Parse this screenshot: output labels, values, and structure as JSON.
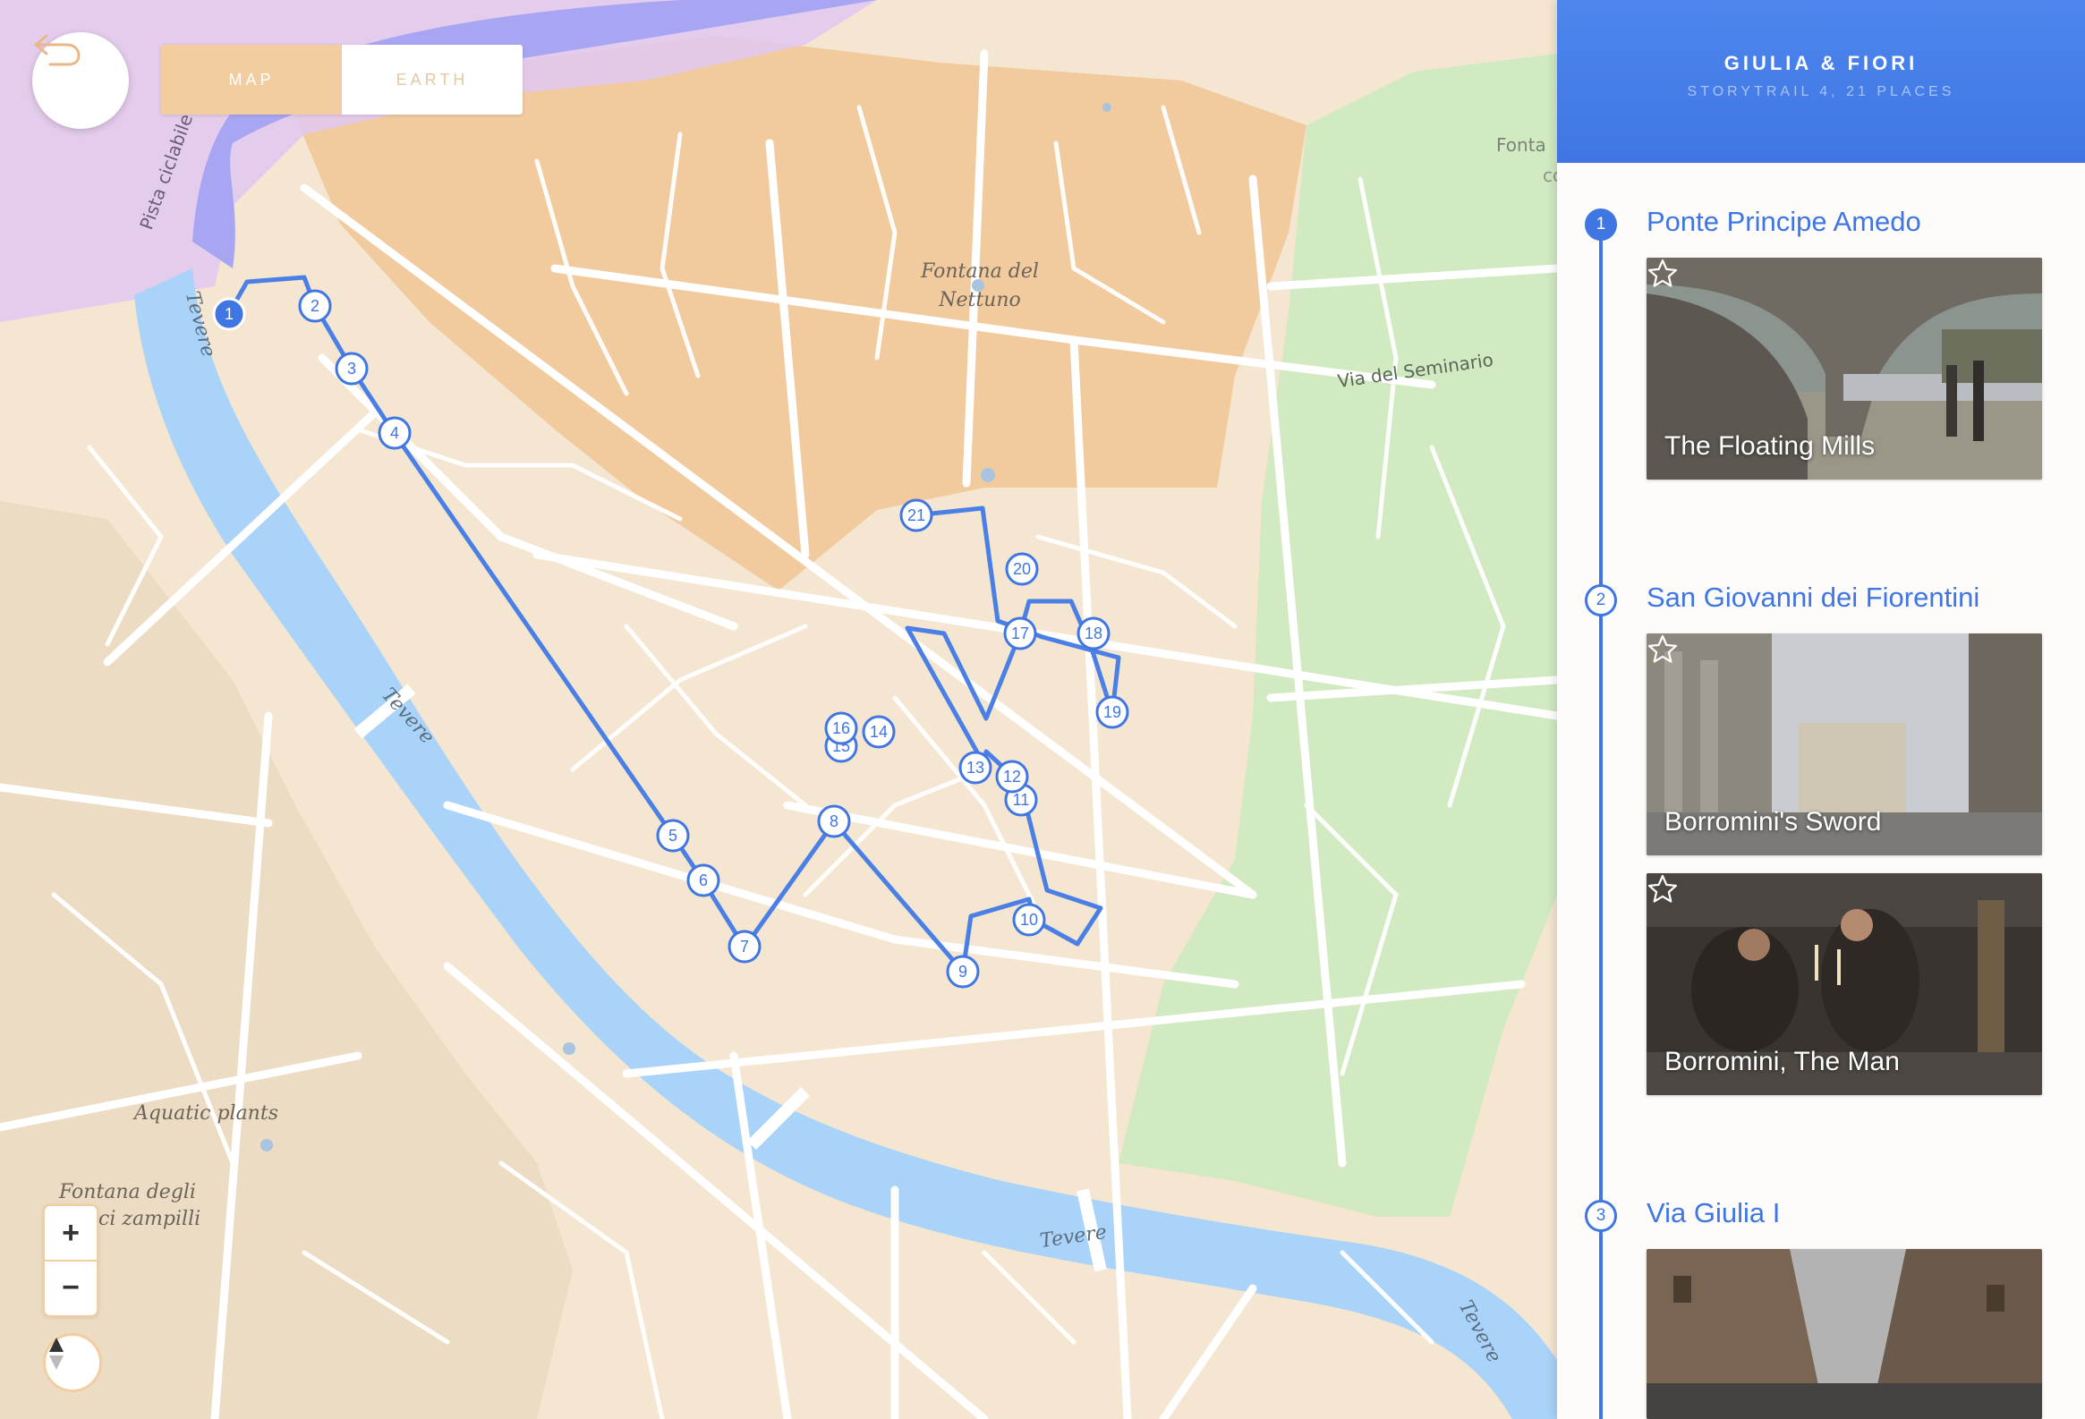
{
  "toolbar": {
    "map_label": "MAP",
    "earth_label": "EARTH"
  },
  "zoom": {
    "in_label": "+",
    "out_label": "−"
  },
  "map": {
    "labels": {
      "fontana_nettuno": "Fontana del Nettuno",
      "via_seminario": "Via del Seminario",
      "tevere_1": "Tevere",
      "tevere_2": "Tevere",
      "tevere_3": "Tevere",
      "tevere_4": "Tevere",
      "aquatic_plants": "Aquatic plants",
      "fontana_zampilli_1": "Fontana degli",
      "fontana_zampilli_2": "ci zampilli",
      "pista_ciclabile": "Pista ciclabile",
      "fonta": "Fonta",
      "colonna": "colonna"
    },
    "route_markers": [
      "1",
      "2",
      "3",
      "4",
      "5",
      "6",
      "7",
      "8",
      "9",
      "10",
      "11",
      "12",
      "13",
      "14",
      "15",
      "16",
      "17",
      "18",
      "19",
      "20",
      "21"
    ],
    "colors": {
      "route": "#4a7fe6",
      "river": "#a9d3f8",
      "orange_zone": "#f0c495",
      "green_zone": "#cdeac0",
      "purple_zone": "#e2c9ee"
    }
  },
  "panel": {
    "title": "GIULIA & FIORI",
    "subtitle": "STORYTRAIL 4, 21 PLACES",
    "places": [
      {
        "number": "1",
        "title": "Ponte Principe Amedo",
        "cards": [
          "The Floating Mills"
        ]
      },
      {
        "number": "2",
        "title": "San Giovanni dei Fiorentini",
        "cards": [
          "Borromini's Sword",
          "Borromini, The Man"
        ]
      },
      {
        "number": "3",
        "title": "Via Giulia I",
        "cards": [
          ""
        ]
      }
    ],
    "accent": "#3f76e3"
  }
}
